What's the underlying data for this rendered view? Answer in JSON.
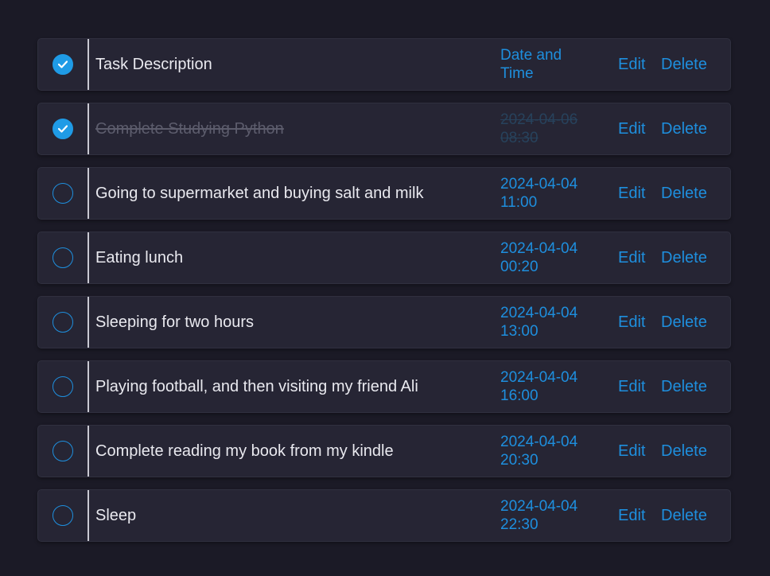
{
  "colors": {
    "background": "#1b1a26",
    "row_background": "#262534",
    "accent": "#1e8fde",
    "text": "#e9e9ef",
    "completed_text": "#5c5c6c"
  },
  "header": {
    "checked": true,
    "description": "Task Description",
    "date_line1": "Date and",
    "date_line2": "Time",
    "edit_label": "Edit",
    "delete_label": "Delete"
  },
  "tasks": [
    {
      "checked": true,
      "description": "Complete Studying Python",
      "date": "2024-04-06",
      "time": "08:30",
      "edit_label": "Edit",
      "delete_label": "Delete"
    },
    {
      "checked": false,
      "description": "Going to supermarket and buying salt and milk",
      "date": "2024-04-04",
      "time": "11:00",
      "edit_label": "Edit",
      "delete_label": "Delete"
    },
    {
      "checked": false,
      "description": "Eating lunch",
      "date": "2024-04-04",
      "time": "00:20",
      "edit_label": "Edit",
      "delete_label": "Delete"
    },
    {
      "checked": false,
      "description": "Sleeping for two hours",
      "date": "2024-04-04",
      "time": "13:00",
      "edit_label": "Edit",
      "delete_label": "Delete"
    },
    {
      "checked": false,
      "description": "Playing football, and then visiting my friend Ali",
      "date": "2024-04-04",
      "time": "16:00",
      "edit_label": "Edit",
      "delete_label": "Delete"
    },
    {
      "checked": false,
      "description": "Complete reading my book from my kindle",
      "date": "2024-04-04",
      "time": "20:30",
      "edit_label": "Edit",
      "delete_label": "Delete"
    },
    {
      "checked": false,
      "description": "Sleep",
      "date": "2024-04-04",
      "time": "22:30",
      "edit_label": "Edit",
      "delete_label": "Delete"
    }
  ]
}
